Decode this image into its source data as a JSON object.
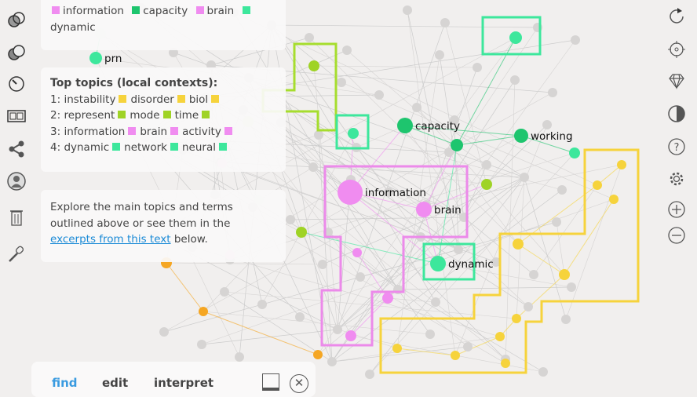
{
  "top_panel": {
    "terms": [
      {
        "label": "information",
        "color": "#f08cf0"
      },
      {
        "label": "capacity",
        "color": "#1ec56e"
      },
      {
        "label": "brain",
        "color": "#f08cf0"
      },
      {
        "label": "dynamic",
        "color": "#3de79c"
      }
    ]
  },
  "topics_panel": {
    "title": "Top topics (local contexts):",
    "topics": [
      {
        "num": "1:",
        "terms": [
          "instability",
          "disorder",
          "biol"
        ],
        "color": "#f6d33c"
      },
      {
        "num": "2:",
        "terms": [
          "represent",
          "mode",
          "time"
        ],
        "color": "#9fd325"
      },
      {
        "num": "3:",
        "terms": [
          "information",
          "brain",
          "activity"
        ],
        "color": "#f08cf0"
      },
      {
        "num": "4:",
        "terms": [
          "dynamic",
          "network",
          "neural"
        ],
        "color": "#3de79c"
      }
    ]
  },
  "explore_panel": {
    "text_before": "Explore the main topics and terms outlined above or see them in the ",
    "link": "excerpts from this text",
    "text_after": " below."
  },
  "graph": {
    "labels": {
      "prn": "prn",
      "capacity": "capacity",
      "working": "working",
      "information": "information",
      "brain": "brain",
      "dynamic": "dynamic"
    }
  },
  "bottom_bar": {
    "tabs": [
      "find",
      "edit",
      "interpret"
    ],
    "active": "find"
  },
  "colors": {
    "accent": "#3a9be0"
  }
}
